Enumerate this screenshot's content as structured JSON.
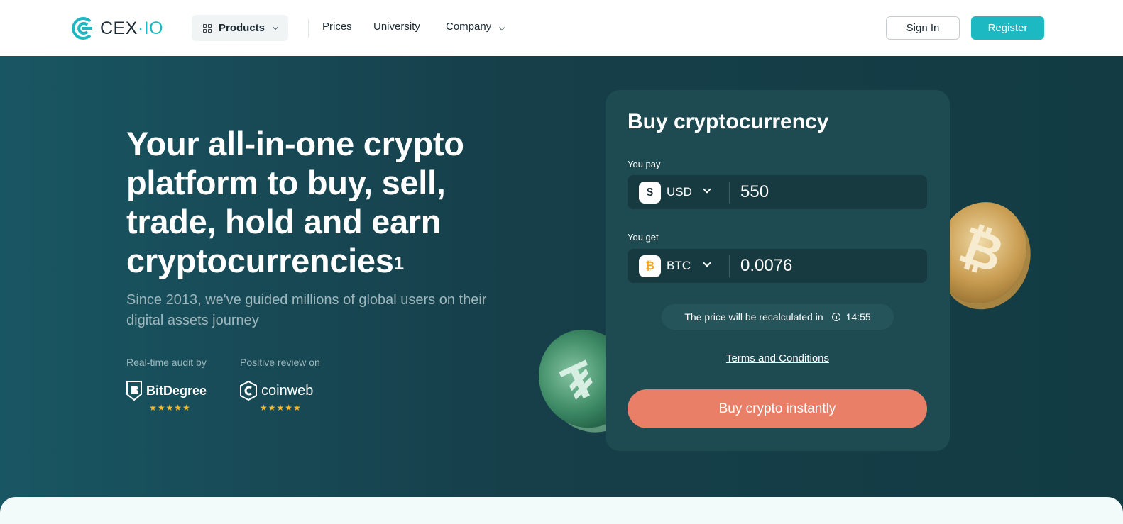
{
  "header": {
    "logo": {
      "text_main": "CEX",
      "text_suffix": "IO"
    },
    "products_label": "Products",
    "nav": [
      "Prices",
      "University",
      "Company"
    ],
    "signin_label": "Sign In",
    "register_label": "Register"
  },
  "hero": {
    "title": "Your all-in-one crypto platform to buy, sell, trade, hold and earn cryptocurrencies",
    "title_sup": "1",
    "subtitle": "Since 2013, we've guided millions of global users on their digital assets journey",
    "audit_label": "Real-time audit by",
    "review_label": "Positive review on",
    "audit_brand": "BitDegree",
    "review_brand": "coinweb",
    "stars": "★★★★★"
  },
  "buy_card": {
    "title": "Buy cryptocurrency",
    "pay_label": "You pay",
    "pay_currency": "USD",
    "pay_symbol": "$",
    "pay_value": "550",
    "get_label": "You get",
    "get_currency": "BTC",
    "get_symbol": "₿",
    "get_value": "0.0076",
    "recalc_text": "The price will be recalculated in",
    "recalc_time": "14:55",
    "terms": "Terms and Conditions",
    "buy_button": "Buy crypto instantly"
  },
  "colors": {
    "accent": "#1db9c3",
    "cta": "#ea7f68",
    "hero_bg": "#163f4a",
    "card_bg": "#1e4b52"
  }
}
